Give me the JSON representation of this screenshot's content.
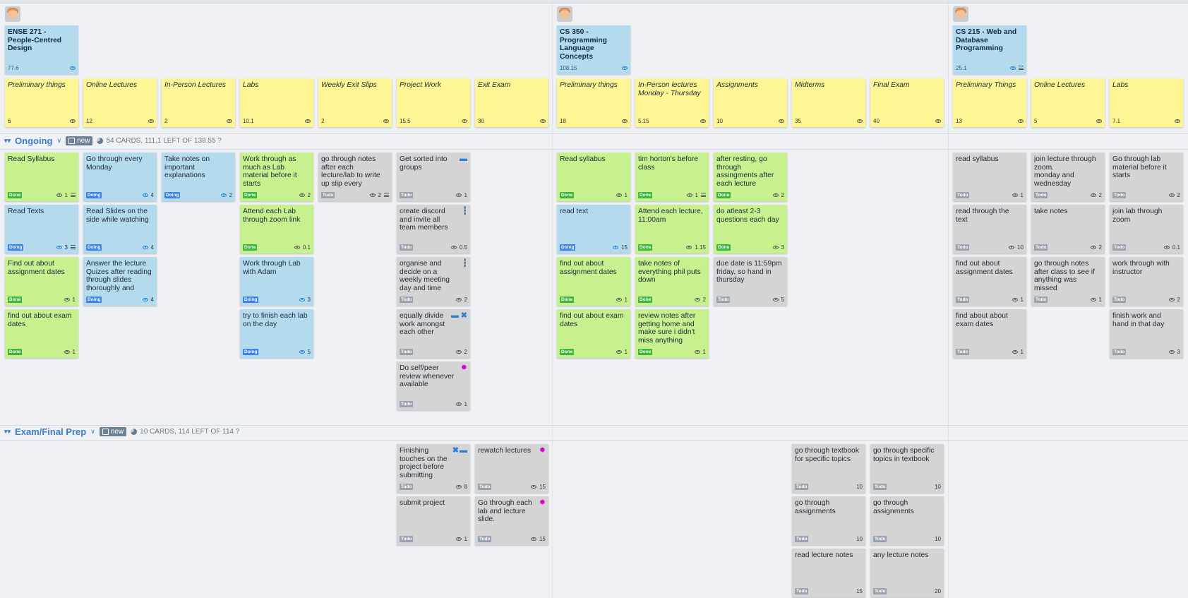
{
  "colors": {
    "blue_card": "#b4daed",
    "green_card": "#c7f08f",
    "gray_card": "#d4d4d4",
    "yellow_card": "#fef694",
    "done_badge": "#3eb73c",
    "doing_badge": "#3f82e6",
    "todo_badge": "#9aa2ad",
    "lane_title": "#3d7cc9"
  },
  "projects": [
    {
      "title": "ENSE 271 - People-Centred Design",
      "value": "77.6",
      "columns": [
        {
          "title": "Preliminary things",
          "value": "6"
        },
        {
          "title": "Online Lectures",
          "value": "12"
        },
        {
          "title": "In-Person Lectures",
          "value": "2"
        },
        {
          "title": "Labs",
          "value": "10.1"
        },
        {
          "title": "Weekly Exit Slips",
          "value": "2"
        },
        {
          "title": "Project Work",
          "value": "15.5"
        },
        {
          "title": "Exit Exam",
          "value": "30"
        }
      ]
    },
    {
      "title": "CS 350 - Programming Language Concepts",
      "value": "108.15",
      "columns": [
        {
          "title": "Preliminary things",
          "value": "18"
        },
        {
          "title": "In-Person lectures Monday - Thursday",
          "value": "5.15"
        },
        {
          "title": "Assignments",
          "value": "10"
        },
        {
          "title": "Midterms",
          "value": "35"
        },
        {
          "title": "Final Exam",
          "value": "40"
        }
      ]
    },
    {
      "title": "CS 215 - Web and Database Programming",
      "value": "25.1",
      "columns": [
        {
          "title": "Preliminary Things",
          "value": "13"
        },
        {
          "title": "Online Lectures",
          "value": "5"
        },
        {
          "title": "Labs",
          "value": "7.1"
        }
      ]
    }
  ],
  "lanes": [
    {
      "name": "Ongoing",
      "new_label": "new",
      "stats": "54 CARDS, 111.1 LEFT OF 138.55 ?"
    },
    {
      "name": "Exam/Final Prep",
      "new_label": "new",
      "stats": "10 CARDS, 114 LEFT OF 114 ?"
    }
  ],
  "cards": [
    {
      "title": "Read Syllabus",
      "status": "Done",
      "value": "1"
    },
    {
      "title": "Read Texts",
      "status": "Doing",
      "value": "3"
    },
    {
      "title": "Find out about assignment dates",
      "status": "Done",
      "value": "1"
    },
    {
      "title": "find out about exam dates",
      "status": "Done",
      "value": "1"
    },
    {
      "title": "Go through every Monday",
      "status": "Doing",
      "value": "4"
    },
    {
      "title": "Read Slides on the side while watching",
      "status": "Doing",
      "value": "4"
    },
    {
      "title": "Answer the lecture Quizes after reading through slides thoroughly and",
      "status": "Doing",
      "value": "4"
    },
    {
      "title": "Take notes on important explanations",
      "status": "Doing",
      "value": "2"
    },
    {
      "title": "Work through as much as Lab material before it starts",
      "status": "Done",
      "value": "2"
    },
    {
      "title": "Attend each Lab through zoom link",
      "status": "Done",
      "value": "0.1"
    },
    {
      "title": "Work through Lab with Adam",
      "status": "Doing",
      "value": "3"
    },
    {
      "title": "try to finish each lab on the day",
      "status": "Doing",
      "value": "5"
    },
    {
      "title": "go through notes after each lecture/lab to write up slip every thursday",
      "status": "Todo",
      "value": "2"
    },
    {
      "title": "Get sorted into groups",
      "status": "Todo",
      "value": "1"
    },
    {
      "title": "create discord and invite all team members",
      "status": "Todo",
      "value": "0.5"
    },
    {
      "title": "organise and decide on a weekly meeting day and time",
      "status": "Todo",
      "value": "2"
    },
    {
      "title": "equally divide work amongst each other",
      "status": "Todo",
      "value": "2"
    },
    {
      "title": "Do self/peer review whenever available",
      "status": "Todo",
      "value": "1"
    },
    {
      "title": "Read syllabus",
      "status": "Done",
      "value": "1"
    },
    {
      "title": "read text",
      "status": "Doing",
      "value": "15"
    },
    {
      "title": "find out about assignment dates",
      "status": "Done",
      "value": "1"
    },
    {
      "title": "find out about exam dates",
      "status": "Done",
      "value": "1"
    },
    {
      "title": "tim horton's before class",
      "status": "Done",
      "value": "1"
    },
    {
      "title": "Attend each lecture, 11:00am",
      "status": "Done",
      "value": "1.15"
    },
    {
      "title": "take notes of everything phil puts down",
      "status": "Done",
      "value": "2"
    },
    {
      "title": "review notes after getting home and make sure i didn't miss anything",
      "status": "Done",
      "value": "1"
    },
    {
      "title": "after resting, go through assingments after each lecture",
      "status": "Done",
      "value": "2"
    },
    {
      "title": "do atleast 2-3 questions each day",
      "status": "Done",
      "value": "3"
    },
    {
      "title": "due date is 11:59pm friday, so hand in thursday",
      "status": "Todo",
      "value": "5"
    },
    {
      "title": "read syllabus",
      "status": "Todo",
      "value": "1"
    },
    {
      "title": "read through the text",
      "status": "Todo",
      "value": "10"
    },
    {
      "title": "find out about assignment dates",
      "status": "Todo",
      "value": "1"
    },
    {
      "title": "find about about exam dates",
      "status": "Todo",
      "value": "1"
    },
    {
      "title": "join lecture through zoom.\nmonday and wednesday",
      "status": "Todo",
      "value": "2"
    },
    {
      "title": "take notes",
      "status": "Todo",
      "value": "2"
    },
    {
      "title": "go through notes after class to see if anything was missed",
      "status": "Todo",
      "value": "1"
    },
    {
      "title": "Go through lab material before it starts",
      "status": "Todo",
      "value": "2"
    },
    {
      "title": "join lab through zoom",
      "status": "Todo",
      "value": "0.1"
    },
    {
      "title": "work through with instructor",
      "status": "Todo",
      "value": "2"
    },
    {
      "title": "finish work and hand in that day",
      "status": "Todo",
      "value": "3"
    },
    {
      "title": "Finishing touches on the project before submitting",
      "status": "Todo",
      "value": "8"
    },
    {
      "title": "submit project",
      "status": "Todo",
      "value": "1"
    },
    {
      "title": "rewatch lectures",
      "status": "Todo",
      "value": "15"
    },
    {
      "title": "Go through each lab and lecture slide.",
      "status": "Todo",
      "value": "15"
    },
    {
      "title": "go through textbook for specific topics",
      "status": "Todo",
      "value": "10"
    },
    {
      "title": "go through assignments",
      "status": "Todo",
      "value": "10"
    },
    {
      "title": "read lecture notes",
      "status": "Todo",
      "value": "15"
    },
    {
      "title": "go through specific topics in textbook",
      "status": "Todo",
      "value": "10"
    },
    {
      "title": "go through assignments",
      "status": "Todo",
      "value": "10"
    },
    {
      "title": "any lecture notes",
      "status": "Todo",
      "value": "20"
    }
  ]
}
